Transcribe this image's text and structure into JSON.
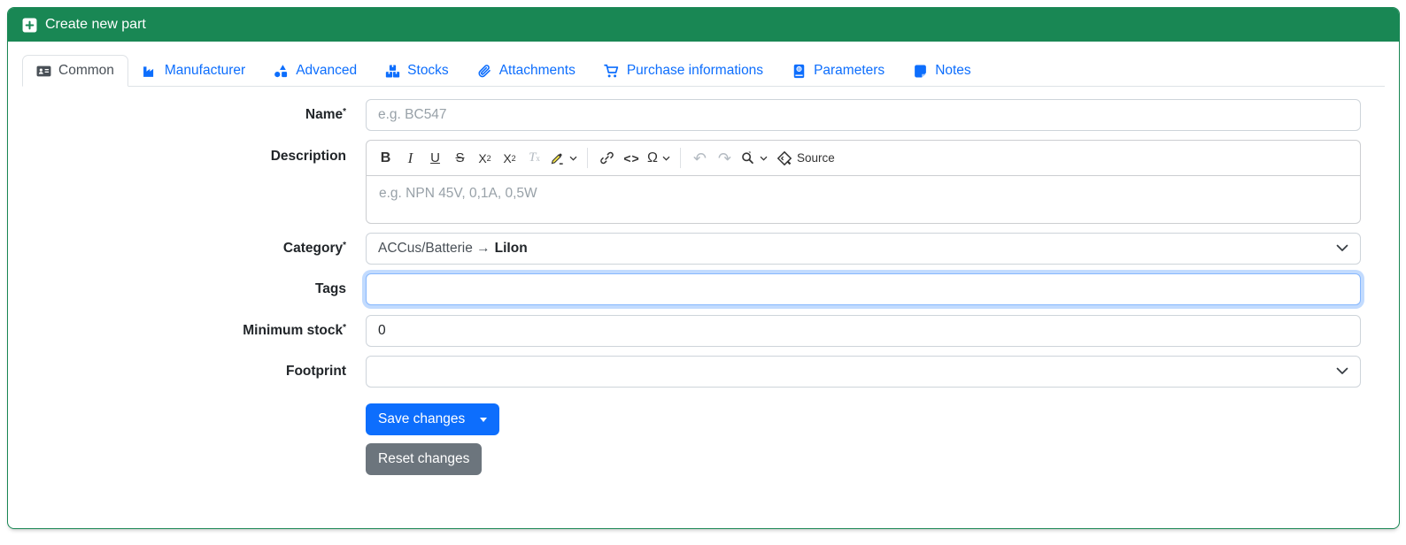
{
  "header": {
    "title": "Create new part",
    "icon": "plus-square-icon",
    "bg_color": "#198754"
  },
  "tabs": [
    {
      "label": "Common",
      "icon": "address-card-icon",
      "active": true
    },
    {
      "label": "Manufacturer",
      "icon": "factory-icon",
      "active": false
    },
    {
      "label": "Advanced",
      "icon": "shapes-icon",
      "active": false
    },
    {
      "label": "Stocks",
      "icon": "boxes-stacked-icon",
      "active": false
    },
    {
      "label": "Attachments",
      "icon": "paperclip-icon",
      "active": false
    },
    {
      "label": "Purchase informations",
      "icon": "cart-icon",
      "active": false
    },
    {
      "label": "Parameters",
      "icon": "book-icon",
      "active": false
    },
    {
      "label": "Notes",
      "icon": "sticky-note-icon",
      "active": false
    }
  ],
  "form": {
    "name": {
      "label": "Name",
      "required": "*",
      "placeholder": "e.g. BC547",
      "value": ""
    },
    "description": {
      "label": "Description",
      "placeholder": "e.g. NPN 45V, 0,1A, 0,5W",
      "value": "",
      "toolbar": {
        "bold": "B",
        "italic": "I",
        "underline": "U",
        "strikethrough": "S",
        "subscript_base": "X",
        "subscript_small": "2",
        "superscript_base": "X",
        "superscript_small": "2",
        "remove_format_base": "T",
        "remove_format_small": "x",
        "code": "<>",
        "omega": "Ω",
        "undo": "↶",
        "redo": "↷",
        "source_label": "Source"
      }
    },
    "category": {
      "label": "Category",
      "required": "*",
      "value_prefix": "ACCus/Batterie →",
      "value_selected": "LiIon"
    },
    "tags": {
      "label": "Tags",
      "value": "",
      "focused": true
    },
    "minimum_stock": {
      "label": "Minimum stock",
      "required": "*",
      "value": "0"
    },
    "footprint": {
      "label": "Footprint",
      "value": ""
    }
  },
  "buttons": {
    "save": "Save changes",
    "reset": "Reset changes"
  },
  "colors": {
    "header_green": "#198754",
    "tab_blue": "#0d6efd",
    "active_tab_text": "#495057",
    "save_blue": "#0d6efd",
    "reset_gray": "#6c757d",
    "focus_border": "#86b7fe",
    "input_border": "#ced4da"
  }
}
